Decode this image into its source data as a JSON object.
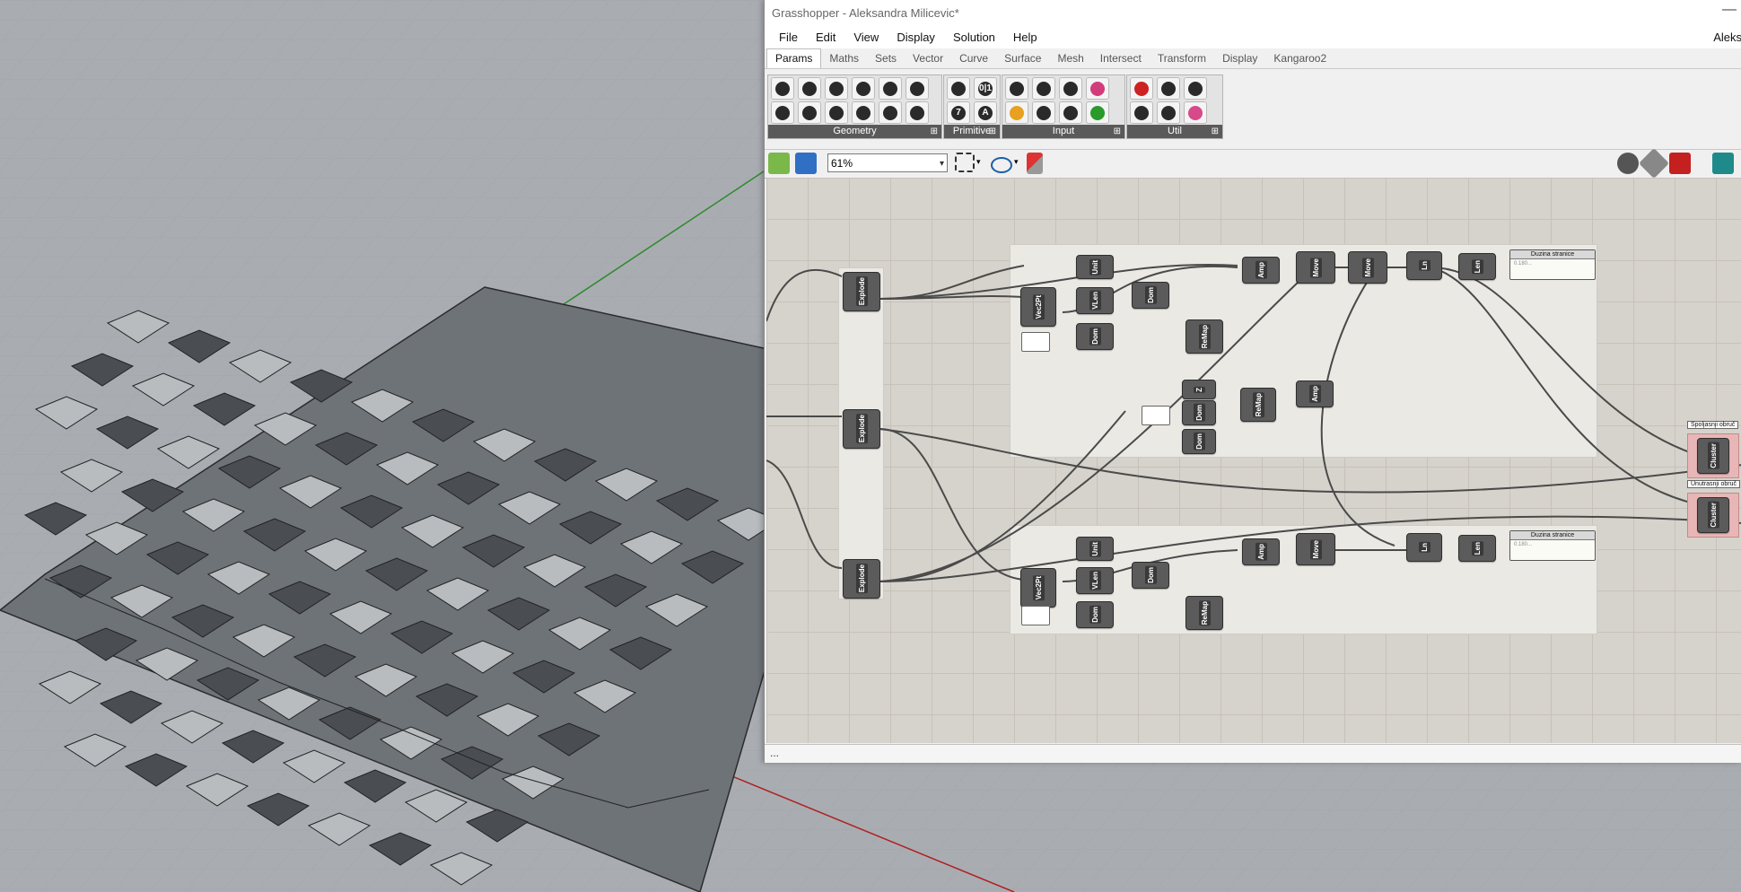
{
  "app": {
    "window_title": "Grasshopper - Aleksandra Milicevic*",
    "user_label": "Aleks",
    "minimize_glyph": "—"
  },
  "menu": [
    "File",
    "Edit",
    "View",
    "Display",
    "Solution",
    "Help"
  ],
  "tabs": [
    "Params",
    "Maths",
    "Sets",
    "Vector",
    "Curve",
    "Surface",
    "Mesh",
    "Intersect",
    "Transform",
    "Display",
    "Kangaroo2"
  ],
  "active_tab": "Params",
  "ribbon_panels": [
    {
      "name": "Geometry",
      "icons": [
        "geometry-icon",
        "circle-icon",
        "curve-icon",
        "surface-icon",
        "mesh-icon",
        "field-icon",
        "point-icon",
        "line-icon",
        "brep-icon",
        "plane-icon",
        "box-icon",
        "transform-icon"
      ]
    },
    {
      "name": "Primitive",
      "icons": [
        "pencil-icon",
        "toggle-icon",
        "number-icon",
        "text-icon"
      ]
    },
    {
      "name": "Input",
      "icons": [
        "import-icon",
        "panel-icon",
        "slider-icon",
        "swatch-icon",
        "gradient-icon",
        "button-icon",
        "list-icon",
        "matrix-icon"
      ]
    },
    {
      "name": "Util",
      "icons": [
        "cherry-icon",
        "relay-icon",
        "expand-icon",
        "tree-icon",
        "arrow-icon",
        "flask-icon"
      ]
    }
  ],
  "ribbon_glyphs": {
    "number-icon": "7",
    "text-icon": "A",
    "toggle-icon": "0|1"
  },
  "panel_expand": "⊞",
  "zoom": {
    "value": "61%",
    "arrow": "▾"
  },
  "toolbar_dropdown": "▾",
  "statusbar_text": "...",
  "components": {
    "explode": "Explode",
    "unit": "Unit",
    "vec2pt": "Vec2Pt",
    "vlen": "VLen",
    "dom": "Dom",
    "remap": "ReMap",
    "amp": "Amp",
    "move": "Move",
    "ln": "Ln",
    "len": "Len",
    "z": "Z",
    "cluster": "Cluster"
  },
  "panels": {
    "top_title": "Duzina stranice",
    "bottom_title": "Duzina stranice",
    "value": "0.180..."
  },
  "clusters": {
    "outer_label": "Spoljasnji obruč",
    "inner_label": "Unutrasnji obruč"
  },
  "colors": {
    "rhino_bg": "#a9adb2",
    "canvas_bg": "#d6d3cc",
    "component": "#5b5b5b",
    "cluster_group": "#e8b6b6",
    "axis_green": "#2d8a2d",
    "axis_red": "#b02020"
  }
}
